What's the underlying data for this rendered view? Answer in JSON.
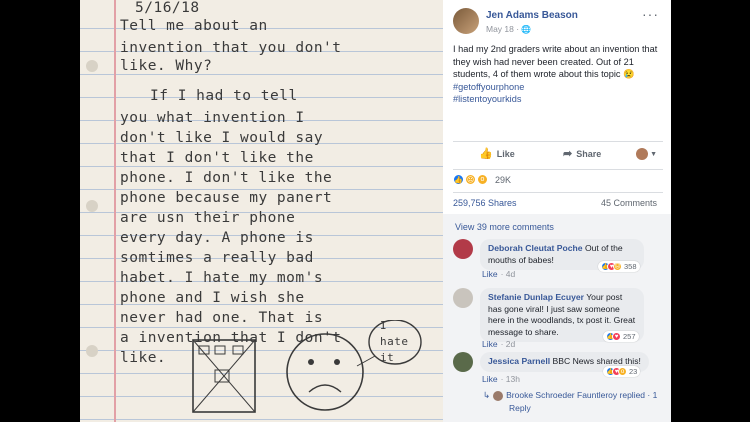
{
  "photo": {
    "lines": [
      "5/16/18",
      "Tell me about an",
      "invention that you don't",
      "like. Why?",
      "If I had to tell",
      "you what invention I",
      "don't like I would say",
      "that I don't like the",
      "phone. I don't like the",
      "phone because my panert",
      "are usn their phone",
      "every day. A phone is",
      "somtimes a really bad",
      "habet. I hate my mom's",
      "phone and I wish she",
      "never had one. That is",
      "a invention that I don't",
      "like."
    ],
    "bubble_text": "I hate it"
  },
  "post": {
    "author": "Jen Adams Beason",
    "date": "May 18 ·",
    "more_label": "···",
    "text": "I had my 2nd graders write about an invention that they wish had never been created. Out of 21 students, 4 of them wrote about this topic 😢",
    "hashtags": [
      "#getoffyourphone",
      "#listentoyourkids"
    ],
    "like_label": "Like",
    "share_label": "Share",
    "reactions_count": "29K",
    "shares": "259,756 Shares",
    "comments": "45 Comments",
    "view_more": "View 39 more comments"
  },
  "comments": [
    {
      "name": "Deborah Cleutat Poche",
      "text": "Out of the mouths of babes!",
      "like": "Like",
      "time": "· 4d",
      "reactions": "358",
      "avatar_color": "#b23a48"
    },
    {
      "name": "Stefanie Dunlap Ecuyer",
      "text": "Your post has gone viral! I just saw someone here in the woodlands, tx post it. Great message to share.",
      "like": "Like",
      "time": "· 2d",
      "reactions": "257",
      "avatar_color": "#c9c4bd"
    },
    {
      "name": "Jessica Parnell",
      "text": "BBC News shared this!",
      "like": "Like",
      "time": "· 13h",
      "reactions": "23",
      "avatar_color": "#5a6a4a"
    }
  ],
  "reply": {
    "text": "Brooke Schroeder Fauntleroy replied · 1",
    "text2": "Reply"
  }
}
